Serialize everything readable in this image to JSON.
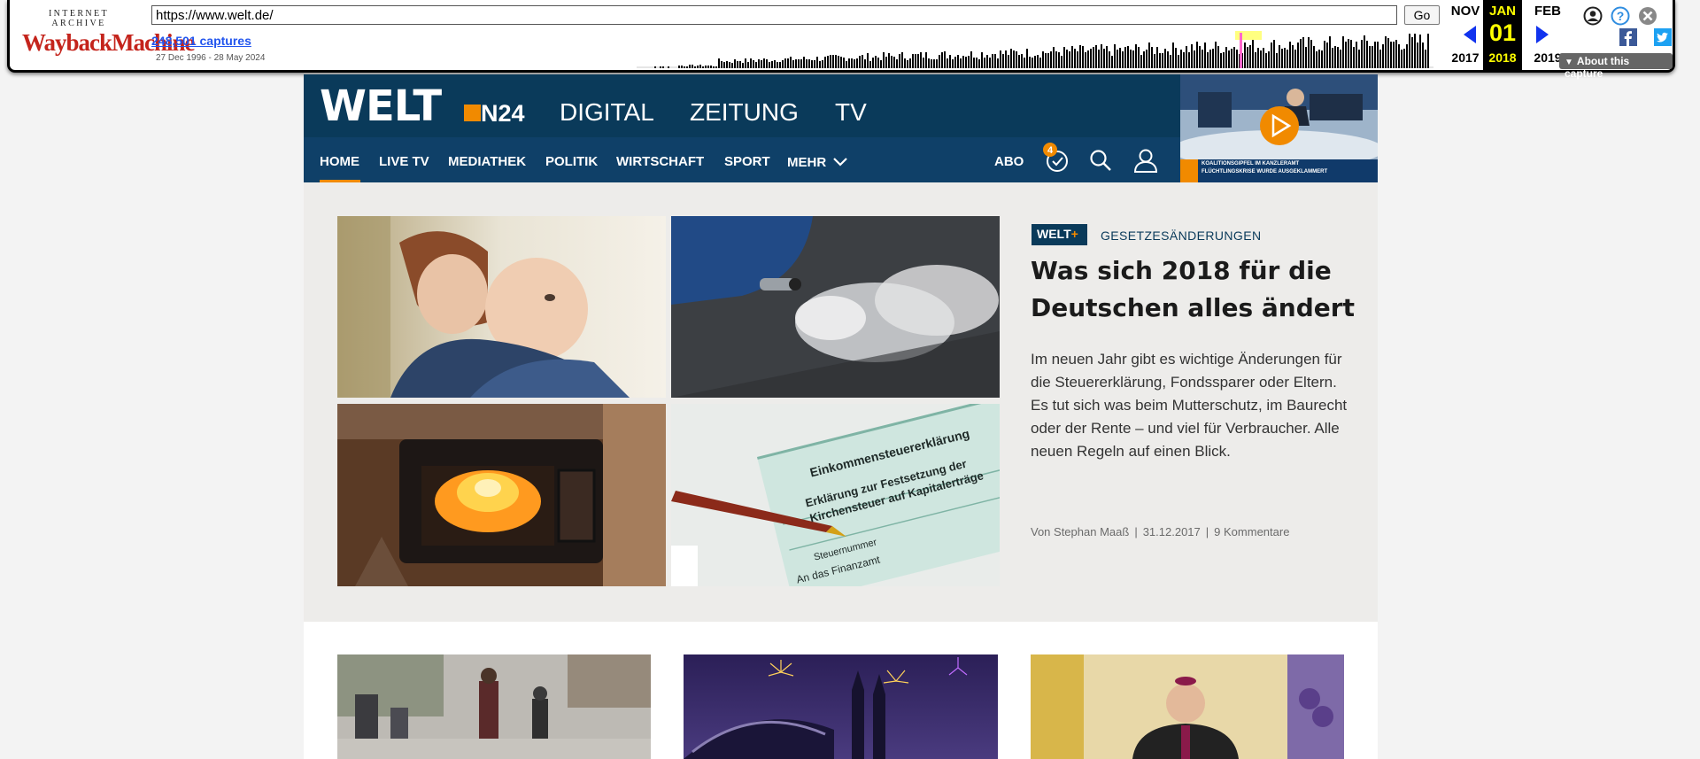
{
  "wayback": {
    "logo_top": "INTERNET ARCHIVE",
    "logo_main": "WaybackMachine",
    "url": "https://www.welt.de/",
    "go_label": "Go",
    "captures": "248,501 captures",
    "range": "27 Dec 1996 - 28 May 2024",
    "prev_month": "NOV",
    "cur_month": "JAN",
    "next_month": "FEB",
    "cur_day": "01",
    "prev_year": "2017",
    "cur_year": "2018",
    "next_year": "2019",
    "about": "About this capture",
    "highlight_color": "#ffff00",
    "icons": [
      "user-icon",
      "help-icon",
      "close-icon",
      "facebook-icon",
      "twitter-icon"
    ]
  },
  "site": {
    "logo": "WELT",
    "n24": "N24",
    "top_nav": [
      "DIGITAL",
      "ZEITUNG",
      "TV"
    ],
    "nav": [
      "HOME",
      "LIVE TV",
      "MEDIATHEK",
      "POLITIK",
      "WIRTSCHAFT",
      "SPORT",
      "MEHR"
    ],
    "abo": "ABO",
    "watchlist_badge": "4",
    "brand_color": "#0a3a5a",
    "accent_color": "#f18a00"
  },
  "hero": {
    "badge_main": "WELT",
    "badge_plus": "+",
    "kicker": "GESETZESÄNDERUNGEN",
    "headline": "Was sich 2018 für die Deutschen alles ändert",
    "teaser": "Im neuen Jahr gibt es wichtige Änderungen für die Steuererklärung, Fondssparer oder Eltern. Es tut sich was beim Mutterschutz, im Baurecht oder der Rente – und viel für Verbraucher. Alle neuen Regeln auf einen Blick.",
    "author": "Von Stephan Maaß",
    "date": "31.12.2017",
    "comments": "9 Kommentare",
    "images": [
      "mother-baby-photo",
      "car-exhaust-photo",
      "fireplace-photo",
      "tax-form-photo"
    ]
  },
  "tax_form": {
    "line1": "Einkommensteuererklärung",
    "line2": "Erklärung zur Festsetzung der",
    "line3": "Kirchensteuer auf Kapitalerträge",
    "line4": "Steuernummer",
    "line5": "An das Finanzamt"
  },
  "video_thumb": {
    "ticker1": "KOALITIONSGIPFEL IM KANZLERAMT",
    "ticker2": "FLÜCHTLINGSKRISE WURDE AUSGEKLAMMERT"
  }
}
